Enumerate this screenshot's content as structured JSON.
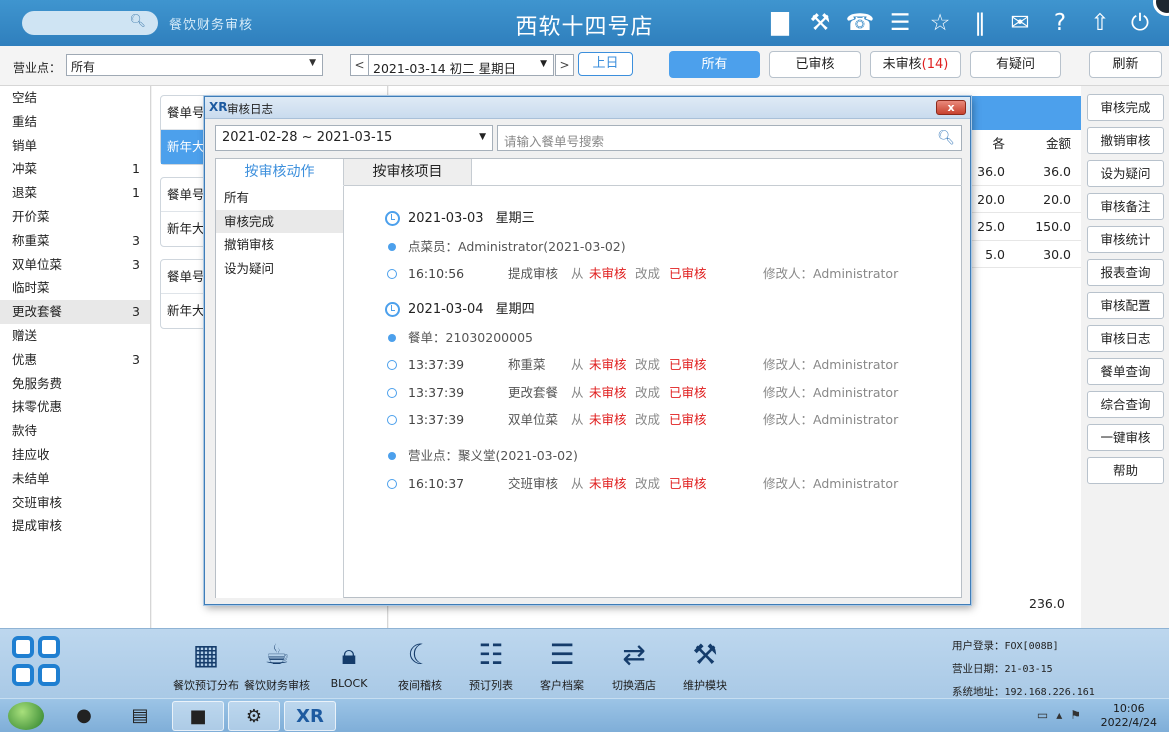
{
  "topbar": {
    "module_name": "餐饮财务审核",
    "store_title": "西软十四号店",
    "icons": [
      "signal-icon",
      "tools-icon",
      "phone-icon",
      "menu-icon",
      "star-icon",
      "columns-icon",
      "mail-icon",
      "help-icon",
      "export-icon",
      "power-icon"
    ]
  },
  "toolbar": {
    "business_point_label": "营业点：",
    "business_point_value": "所有",
    "date_value": "2021-03-14  初二  星期日",
    "prev_day": "上日",
    "filters": {
      "all": "所有",
      "audited": "已审核",
      "unaudited": "未审核",
      "unaudited_count": "(14)",
      "questionable": "有疑问",
      "refresh": "刷新"
    }
  },
  "leftnav": [
    {
      "label": "空结",
      "count": ""
    },
    {
      "label": "重结",
      "count": ""
    },
    {
      "label": "销单",
      "count": ""
    },
    {
      "label": "冲菜",
      "count": "1"
    },
    {
      "label": "退菜",
      "count": "1"
    },
    {
      "label": "开价菜",
      "count": ""
    },
    {
      "label": "称重菜",
      "count": "3"
    },
    {
      "label": "双单位菜",
      "count": "3"
    },
    {
      "label": "临时菜",
      "count": ""
    },
    {
      "label": "更改套餐",
      "count": "3"
    },
    {
      "label": "赠送",
      "count": ""
    },
    {
      "label": "优惠",
      "count": "3"
    },
    {
      "label": "免服务费",
      "count": ""
    },
    {
      "label": "抹零优惠",
      "count": ""
    },
    {
      "label": "款待",
      "count": ""
    },
    {
      "label": "挂应收",
      "count": ""
    },
    {
      "label": "未结单",
      "count": ""
    },
    {
      "label": "交班审核",
      "count": ""
    },
    {
      "label": "提成审核",
      "count": ""
    }
  ],
  "cards": {
    "header_1": "餐单号",
    "row_1": "新年大",
    "header_2": "餐单号",
    "row_2": "新年大",
    "header_3": "餐单号",
    "row_3": "新年大"
  },
  "table": {
    "col_price_partial": "各",
    "col_amount": "金额",
    "rows": [
      {
        "price": "36.0",
        "amount": "36.0"
      },
      {
        "price": "20.0",
        "amount": "20.0"
      },
      {
        "price": "25.0",
        "amount": "150.0"
      },
      {
        "price": "5.0",
        "amount": "30.0"
      }
    ],
    "total": "236.0"
  },
  "actions": [
    "审核完成",
    "撤销审核",
    "设为疑问",
    "审核备注",
    "审核统计",
    "报表查询",
    "审核配置",
    "审核日志",
    "餐单查询",
    "综合查询",
    "一键审核",
    "帮助"
  ],
  "dialog": {
    "logo": "XR",
    "title": "审核日志",
    "close": "x",
    "date_range": "2021-02-28 ~ 2021-03-15",
    "search_placeholder": "请输入餐单号搜索",
    "tabs": {
      "by_action": "按审核动作",
      "by_item": "按审核项目"
    },
    "side_items": [
      "所有",
      "审核完成",
      "撤销审核",
      "设为疑问"
    ],
    "timeline": {
      "g1": {
        "date": "2021-03-03",
        "weekday": "星期三",
        "head": "点菜员：Administrator(2021-03-02)",
        "rows": [
          {
            "time": "16:10:56",
            "item": "提成审核",
            "from": "从",
            "v1": "未审核",
            "chg": "改成",
            "v2": "已审核",
            "mod": "修改人：Administrator"
          }
        ]
      },
      "g2": {
        "date": "2021-03-04",
        "weekday": "星期四",
        "head": "餐单：21030200005",
        "rows": [
          {
            "time": "13:37:39",
            "item": "称重菜",
            "from": "从",
            "v1": "未审核",
            "chg": "改成",
            "v2": "已审核",
            "mod": "修改人：Administrator"
          },
          {
            "time": "13:37:39",
            "item": "更改套餐",
            "from": "从",
            "v1": "未审核",
            "chg": "改成",
            "v2": "已审核",
            "mod": "修改人：Administrator"
          },
          {
            "time": "13:37:39",
            "item": "双单位菜",
            "from": "从",
            "v1": "未审核",
            "chg": "改成",
            "v2": "已审核",
            "mod": "修改人：Administrator"
          }
        ],
        "head2": "营业点：聚义堂(2021-03-02)",
        "rows2": [
          {
            "time": "16:10:37",
            "item": "交班审核",
            "from": "从",
            "v1": "未审核",
            "chg": "改成",
            "v2": "已审核",
            "mod": "修改人：Administrator"
          }
        ]
      }
    }
  },
  "dock": {
    "items": [
      {
        "label": "餐饮预订分布",
        "icon": "grid-calendar-icon"
      },
      {
        "label": "餐饮财务审核",
        "icon": "coffee-cup-icon"
      },
      {
        "label": "BLOCK",
        "icon": "lock-icon"
      },
      {
        "label": "夜间稽核",
        "icon": "moon-icon"
      },
      {
        "label": "预订列表",
        "icon": "document-list-icon"
      },
      {
        "label": "客户档案",
        "icon": "profile-card-icon"
      },
      {
        "label": "切换酒店",
        "icon": "switch-icon"
      },
      {
        "label": "维护模块",
        "icon": "wrench-icon"
      }
    ],
    "login_label": "用户登录：",
    "login_value": "FOX[008B]",
    "date_label": "营业日期：",
    "date_value": "21-03-15",
    "addr_label": "系统地址：",
    "addr_value": "192.168.226.161"
  },
  "taskbar": {
    "time": "10:06",
    "date": "2022/4/24"
  }
}
